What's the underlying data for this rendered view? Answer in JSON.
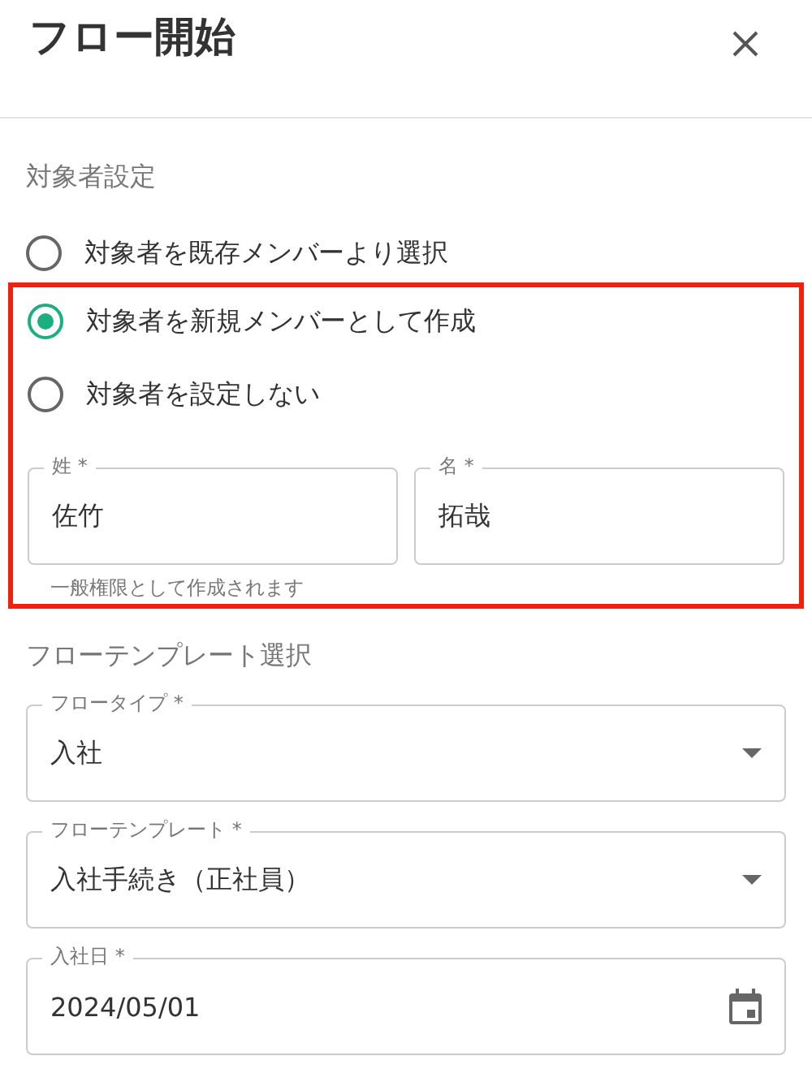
{
  "dialog": {
    "title": "フロー開始"
  },
  "target_section": {
    "heading": "対象者設定",
    "options": [
      {
        "label": "対象者を既存メンバーより選択",
        "selected": false,
        "highlighted": false
      },
      {
        "label": "対象者を新規メンバーとして作成",
        "selected": true,
        "highlighted": true
      },
      {
        "label": "対象者を設定しない",
        "selected": false,
        "highlighted": true
      }
    ],
    "name_fields": {
      "highlighted": true,
      "fields": [
        {
          "label": "姓 *",
          "value": "佐竹"
        },
        {
          "label": "名 *",
          "value": "拓哉"
        }
      ],
      "helper": "一般権限として作成されます"
    }
  },
  "template_section": {
    "heading": "フローテンプレート選択",
    "fields": [
      {
        "kind": "select",
        "label": "フロータイプ *",
        "value": "入社"
      },
      {
        "kind": "select",
        "label": "フローテンプレート *",
        "value": "入社手続き（正社員）"
      },
      {
        "kind": "date",
        "label": "入社日 *",
        "value": "2024/05/01"
      }
    ]
  }
}
